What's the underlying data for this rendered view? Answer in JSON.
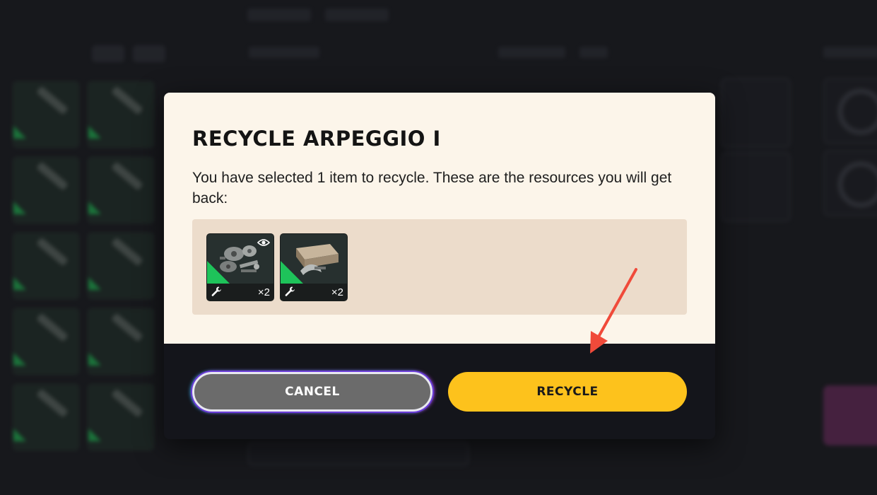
{
  "modal": {
    "title": "RECYCLE ARPEGGIO I",
    "description": "You have selected 1 item to recycle. These are the resources you will get back:",
    "resources": [
      {
        "name_icon": "mechanical-parts-icon",
        "quantity": "×2",
        "has_eye_badge": true
      },
      {
        "name_icon": "crafting-material-icon",
        "quantity": "×2",
        "has_eye_badge": false
      }
    ],
    "cancel_label": "CANCEL",
    "recycle_label": "RECYCLE"
  },
  "colors": {
    "modal_background": "#fcf5ea",
    "resources_panel": "#ecdccb",
    "footer_background": "#14151b",
    "recycle_button": "#fdc21c",
    "cancel_button": "#6b6b6b",
    "rarity_green": "#1ec35a",
    "annotation_arrow": "#f04a3a"
  }
}
